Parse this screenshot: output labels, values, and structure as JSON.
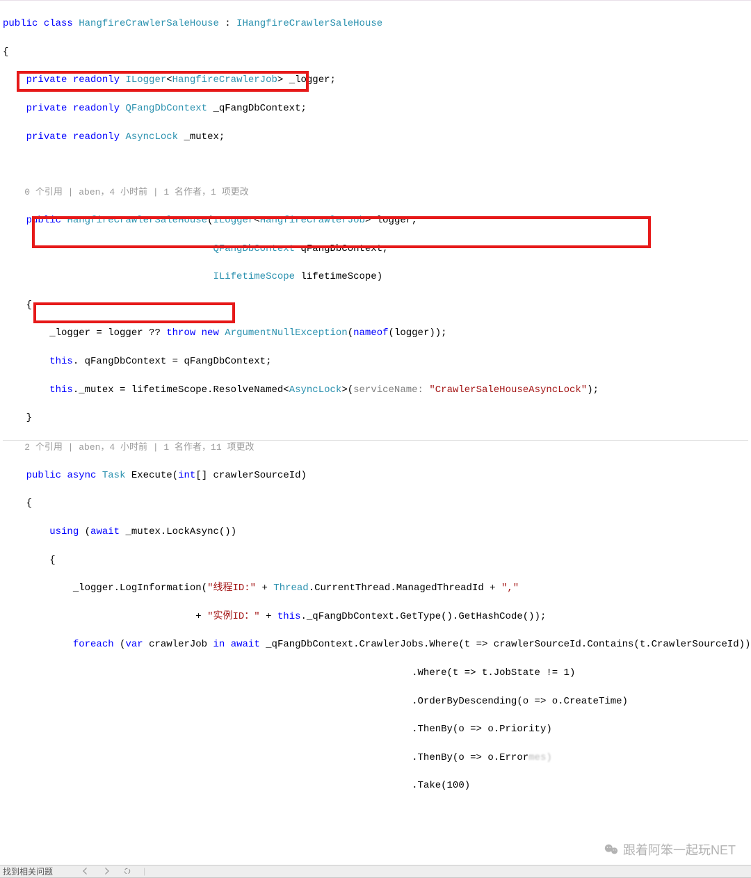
{
  "codelens": {
    "ctor": "0 个引用 | aben，4 小时前 | 1 名作者，1 项更改",
    "execute": "2 个引用 | aben，4 小时前 | 1 名作者，11 项更改"
  },
  "code": {
    "class_kw1": "public",
    "class_kw2": "class",
    "class_name": "HangfireCrawlerSaleHouse",
    "iface": "IHangfireCrawlerSaleHouse",
    "priv_ro": "private readonly",
    "ILogger": "ILogger",
    "HangfireCrawlerJob": "HangfireCrawlerJob",
    "logger_field": "_logger;",
    "QFangDbContext": "QFangDbContext",
    "qfang_field": "_qFangDbContext;",
    "AsyncLock": "AsyncLock",
    "mutex_field": "_mutex;",
    "public_kw": "public",
    "ctor_name": "HangfireCrawlerSaleHouse",
    "logger_param": "logger,",
    "qfang_param": "qFangDbContext,",
    "ILifetimeScope": "ILifetimeScope",
    "lifetime_param": "lifetimeScope)",
    "openbrace": "{",
    "closebrace": "}",
    "assign_logger_pre": "_logger = logger ?? ",
    "throw_new": "throw new",
    "ArgNullEx": "ArgumentNullException",
    "nameof": "nameof",
    "nameof_arg": "(logger));",
    "this_kw": "this",
    "assign_qfang": ". qFangDbContext = qFangDbContext;",
    "assign_mutex_pre": "._mutex = lifetimeScope.ResolveNamed<",
    "assign_mutex_mid": ">(",
    "servicename_label": "serviceName:",
    "servicename_str": "\"CrawlerSaleHouseAsyncLock\"",
    "assign_mutex_end": ");",
    "async_kw": "async",
    "Task": "Task",
    "execute_name": "Execute(",
    "int_kw": "int",
    "crawler_param": "[] crawlerSourceId)",
    "using_kw": "using",
    "await_kw": "await",
    "using_body": " _mutex.LockAsync())",
    "log_call1": "_logger.LogInformation(",
    "str_thread": "\"线程ID:\"",
    "plus": " + ",
    "Thread": "Thread",
    "cur_thread": ".CurrentThread.ManagedThreadId + ",
    "str_comma": "\",\"",
    "str_inst": "\"实例ID：\"",
    "after_inst": "._qFangDbContext.GetType().GetHashCode());",
    "foreach_kw": "foreach",
    "var_kw": "var",
    "crawler_job": " crawlerJob ",
    "in_kw": "in",
    "await2": "await",
    "foreach_tail": " _qFangDbContext.CrawlerJobs.Where(t => crawlerSourceId.Contains(t.CrawlerSourceId))",
    "where2": ".Where(t => t.JobState != 1)",
    "orderby": ".OrderByDescending(o => o.CreateTime)",
    "thenby1": ".ThenBy(o => o.Priority)",
    "thenby2": ".ThenBy(o => o.Error",
    "thenby2_blur": "mes)",
    "take": ".Take(100)"
  },
  "status": {
    "text": "找到相关问题"
  },
  "watermark": "跟着阿笨一起玩NET"
}
